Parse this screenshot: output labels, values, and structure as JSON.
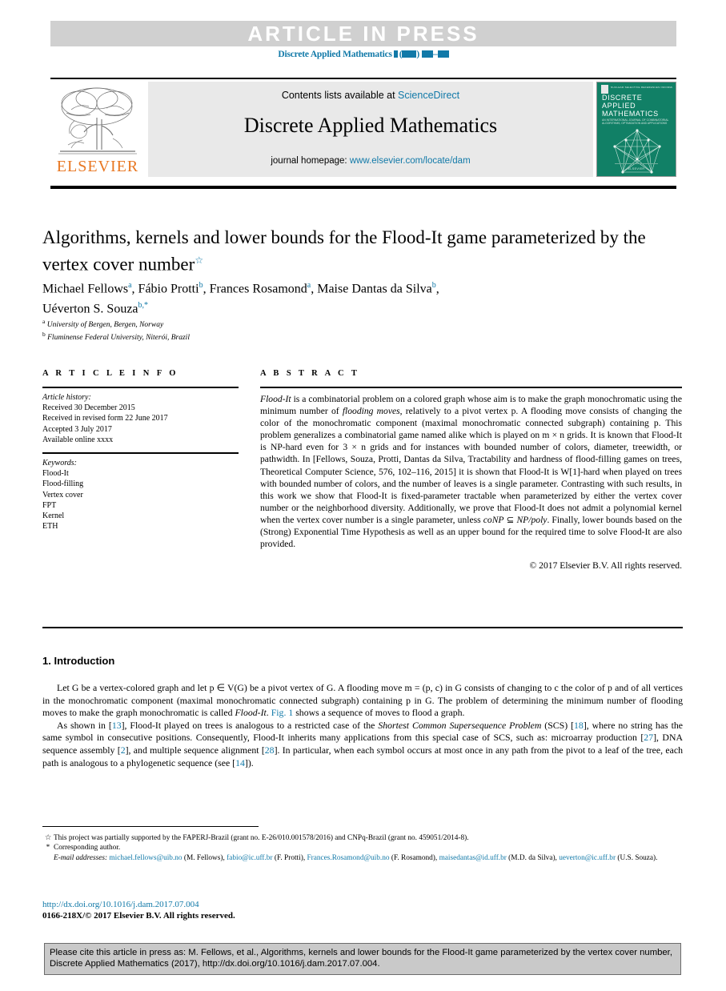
{
  "banner": {
    "press_label": "ARTICLE  IN  PRESS",
    "journal_ref_prefix": "Discrete Applied Mathematics"
  },
  "masthead": {
    "contents_prefix": "Contents lists available at ",
    "sciencedirect": "ScienceDirect",
    "journal_name": "Discrete Applied Mathematics",
    "homepage_prefix": "journal homepage: ",
    "homepage_url": "www.elsevier.com/locate/dam",
    "publisher": "ELSEVIER",
    "cover": {
      "top_words": "NUCLEAR  SELECTIVE  REFERENCES  INFORMATION",
      "title_lines": [
        "DISCRETE",
        "APPLIED",
        "MATHEMATICS"
      ],
      "subtitle": "AN INTERNATIONAL JOURNAL OF COMBINATORIAL ALGORITHMS, OPTIMIZATION AND APPLICATIONS",
      "footer": "ELSEVIER",
      "color": "#118066"
    }
  },
  "article": {
    "title": "Algorithms, kernels and lower bounds for the Flood-It game parameterized by the vertex cover number",
    "title_footnote_mark": "☆",
    "authors": [
      {
        "name": "Michael Fellows",
        "sup": "a"
      },
      {
        "name": "Fábio Protti",
        "sup": "b"
      },
      {
        "name": "Frances Rosamond",
        "sup": "a"
      },
      {
        "name": "Maise Dantas da Silva",
        "sup": "b"
      },
      {
        "name": "Uéverton S. Souza",
        "sup": "b,*"
      }
    ],
    "affiliations": [
      {
        "mark": "a",
        "text": "University of Bergen, Bergen, Norway"
      },
      {
        "mark": "b",
        "text": "Fluminense Federal University, Niterói, Brazil"
      }
    ]
  },
  "article_info": {
    "heading": "A R T I C L E   I N F O",
    "history_label": "Article history:",
    "history": [
      "Received 30 December 2015",
      "Received in revised form 22 June 2017",
      "Accepted 3 July 2017",
      "Available online xxxx"
    ],
    "keywords_label": "Keywords:",
    "keywords": [
      "Flood-It",
      "Flood-filling",
      "Vertex cover",
      "FPT",
      "Kernel",
      "ETH"
    ]
  },
  "abstract": {
    "heading": "A B S T R A C T",
    "paragraph_parts": [
      {
        "t": "Flood-It",
        "i": true
      },
      {
        "t": " is a combinatorial problem on a colored graph whose aim is to make the graph monochromatic using the minimum number of ",
        "i": false
      },
      {
        "t": "flooding moves",
        "i": true
      },
      {
        "t": ", relatively to a pivot vertex p. A flooding move consists of changing the color of the monochromatic component (maximal monochromatic connected subgraph) containing p. This problem generalizes a combinatorial game named alike which is played on m × n grids. It is known that Flood-It is NP-hard even for 3 × n grids and for instances with bounded number of colors, diameter, treewidth, or pathwidth. In [Fellows, Souza, Protti, Dantas da Silva, Tractability and hardness of flood-filling games on trees, Theoretical Computer Science, 576, 102–116, 2015] it is shown that Flood-It is W[1]-hard when played on trees with bounded number of colors, and the number of leaves is a single parameter. Contrasting with such results, in this work we show that Flood-It is fixed-parameter tractable when parameterized by either the vertex cover number or the neighborhood diversity. Additionally, we prove that Flood-It does not admit a polynomial kernel when the vertex cover number is a single parameter, unless ",
        "i": false
      },
      {
        "t": "coNP",
        "i": true
      },
      {
        "t": " ⊆ ",
        "i": false
      },
      {
        "t": "NP/poly",
        "i": true
      },
      {
        "t": ". Finally, lower bounds based on the (Strong) Exponential Time Hypothesis as well as an upper bound for the required time to solve Flood-It are also provided.",
        "i": false
      }
    ],
    "copyright": "© 2017 Elsevier B.V. All rights reserved."
  },
  "body": {
    "section_number": "1.",
    "section_title": "Introduction",
    "paragraph1_parts": [
      {
        "t": "Let G be a vertex-colored graph and let p ∈ V(G) be a pivot vertex of G. A flooding move m = (p, c) in G consists of changing to c the color of p and of all vertices in the monochromatic component (maximal monochromatic connected subgraph) containing p in G. The problem of determining the minimum number of flooding moves to make the graph monochromatic is called ",
        "style": "plain"
      },
      {
        "t": "Flood-It",
        "style": "italic"
      },
      {
        "t": ". ",
        "style": "plain"
      },
      {
        "t": "Fig. 1",
        "style": "link"
      },
      {
        "t": " shows a sequence of moves to flood a graph.",
        "style": "plain"
      }
    ],
    "paragraph2_parts": [
      {
        "t": "As shown in [",
        "style": "plain"
      },
      {
        "t": "13",
        "style": "link"
      },
      {
        "t": "], Flood-It played on trees is analogous to a restricted case of the ",
        "style": "plain"
      },
      {
        "t": "Shortest Common Supersequence Problem",
        "style": "italic"
      },
      {
        "t": " (SCS) [",
        "style": "plain"
      },
      {
        "t": "18",
        "style": "link"
      },
      {
        "t": "], where no string has the same symbol in consecutive positions. Consequently, Flood-It inherits many applications from this special case of SCS, such as: microarray production [",
        "style": "plain"
      },
      {
        "t": "27",
        "style": "link"
      },
      {
        "t": "], DNA sequence assembly [",
        "style": "plain"
      },
      {
        "t": "2",
        "style": "link"
      },
      {
        "t": "], and multiple sequence alignment [",
        "style": "plain"
      },
      {
        "t": "28",
        "style": "link"
      },
      {
        "t": "]. In particular, when each symbol occurs at most once in any path from the pivot to a leaf of the tree, each path is analogous to a phylogenetic sequence (see [",
        "style": "plain"
      },
      {
        "t": "14",
        "style": "link"
      },
      {
        "t": "]).",
        "style": "plain"
      }
    ]
  },
  "footnotes": {
    "funding_mark": "☆",
    "funding": "This project was partially supported by the FAPERJ-Brazil (grant no. E-26/010.001578/2016) and CNPq-Brazil (grant no. 459051/2014-8).",
    "corresponding_mark": "*",
    "corresponding": "Corresponding author.",
    "email_label": "E-mail addresses:",
    "emails": [
      {
        "address": "michael.fellows@uib.no",
        "owner": "(M. Fellows)"
      },
      {
        "address": "fabio@ic.uff.br",
        "owner": "(F. Protti)"
      },
      {
        "address": "Frances.Rosamond@uib.no",
        "owner": "(F. Rosamond)"
      },
      {
        "address": "maisedantas@id.uff.br",
        "owner": "(M.D. da Silva)"
      },
      {
        "address": "ueverton@ic.uff.br",
        "owner": "(U.S. Souza)"
      }
    ],
    "doi": "http://dx.doi.org/10.1016/j.dam.2017.07.004",
    "issn_line": "0166-218X/© 2017 Elsevier B.V. All rights reserved."
  },
  "cite_box": {
    "text": "Please cite this article in press as: M. Fellows, et al., Algorithms, kernels and lower bounds for the Flood-It game parameterized by the vertex cover number, Discrete Applied Mathematics (2017), http://dx.doi.org/10.1016/j.dam.2017.07.004."
  },
  "colors": {
    "accent": "#1179a8",
    "elsevier_orange": "#e87722",
    "banner_gray": "#d0d0d0",
    "box_gray": "#e9e9e9",
    "cite_gray": "#c9c9c9"
  }
}
